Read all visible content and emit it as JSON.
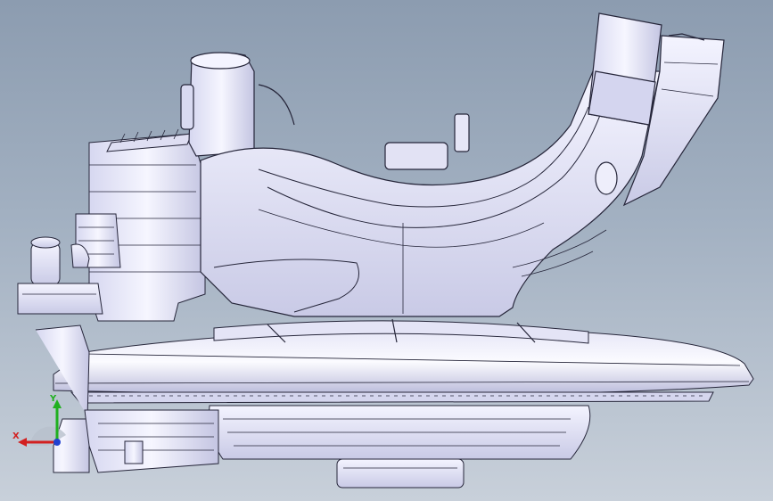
{
  "viewport": {
    "background_top": "#8c9cb0",
    "background_bottom": "#c8d0da",
    "model_fill": "#ececfa",
    "model_shade": "#cfd0ea",
    "model_edge": "#26263a"
  },
  "triad": {
    "x_label": "X",
    "y_label": "Y",
    "x_color": "#d22020",
    "y_color": "#20b020",
    "z_color": "#2040d0"
  }
}
